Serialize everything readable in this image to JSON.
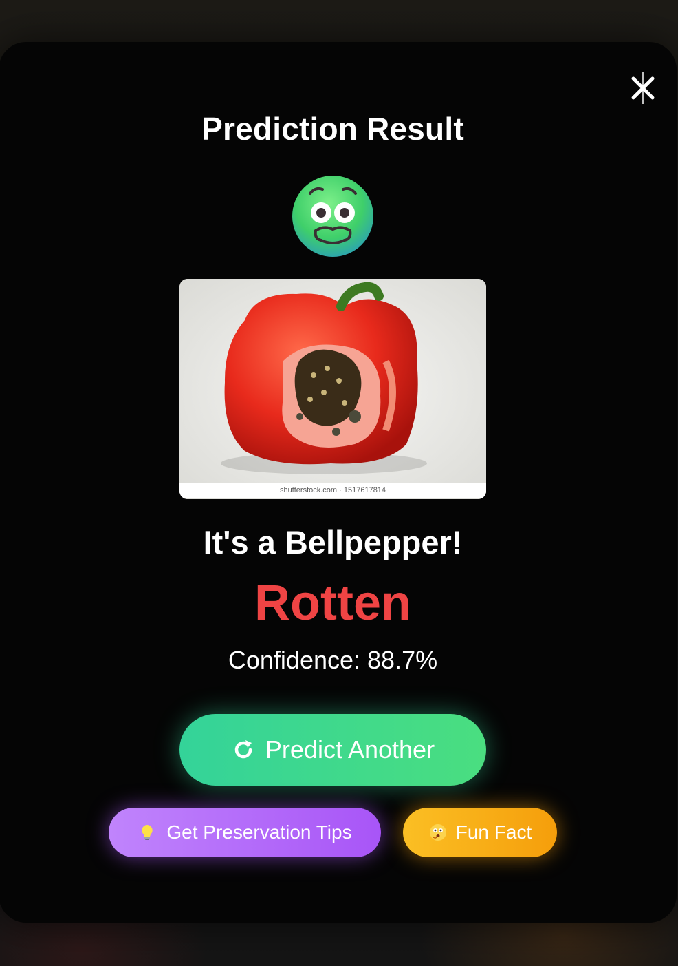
{
  "modal": {
    "title": "Prediction Result",
    "result_icon": "nauseated-face-icon",
    "image": {
      "watermark": "shutterstock.com · 1517617814"
    },
    "fruit_label": "It's a Bellpepper!",
    "status": "Rotten",
    "confidence_text": "Confidence: 88.7%",
    "close_icon": "close-icon"
  },
  "actions": {
    "predict_another": "Predict Another",
    "preservation_tips": "Get Preservation Tips",
    "fun_fact": "Fun Fact"
  },
  "colors": {
    "status_rotten": "#ef4444",
    "primary_button": "#34d399",
    "tips_button": "#a855f7",
    "fact_button": "#f59e0b"
  }
}
